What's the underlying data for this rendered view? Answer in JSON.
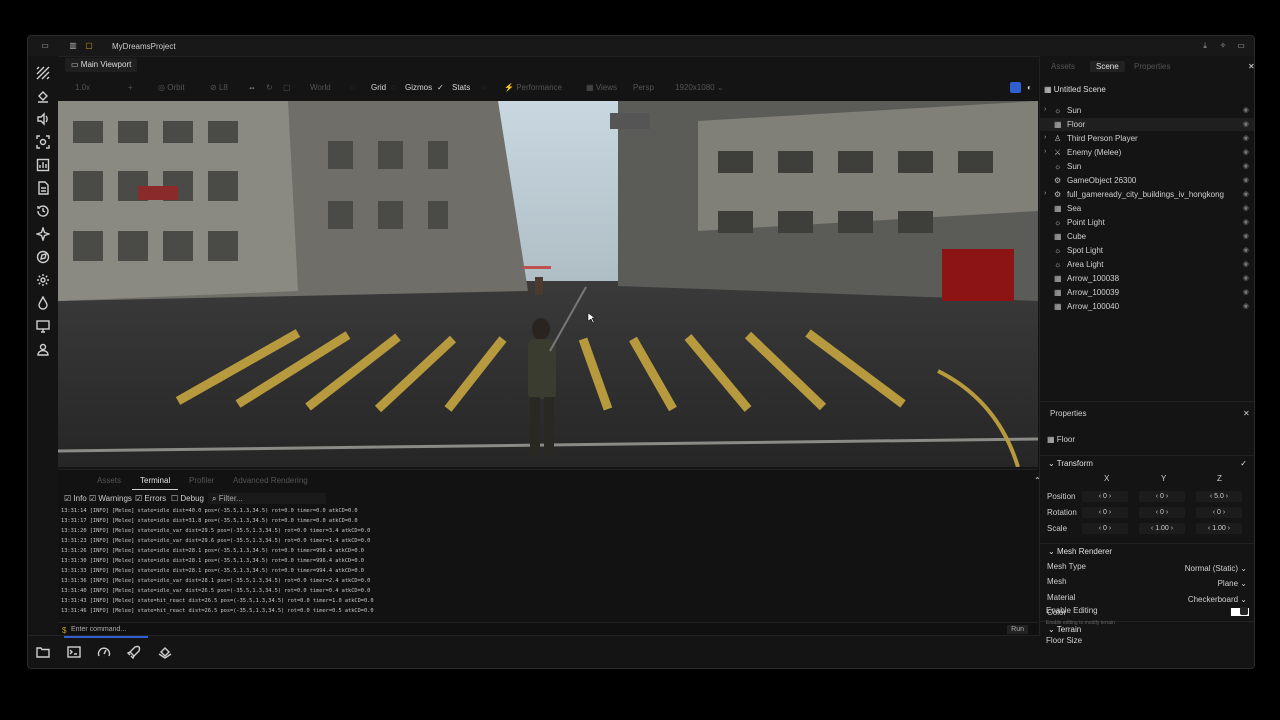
{
  "title_bar": {
    "project": "MyDreamsProject"
  },
  "viewport": {
    "tab_label": "Main Viewport",
    "toolbar": {
      "zoom": "1.0x",
      "orbit": "Orbit",
      "light": "L8",
      "world": "World",
      "grid": "Grid",
      "gizmos": "Gizmos",
      "stats": "Stats",
      "performance": "Performance",
      "views": "Views",
      "persp": "Persp",
      "resolution": "1920x1080"
    }
  },
  "bottom_panel": {
    "tabs": [
      "Assets",
      "Terminal",
      "Profiler",
      "Advanced Rendering"
    ],
    "active_tab": 1,
    "filters": {
      "info": "Info",
      "warnings": "Warnings",
      "errors": "Errors",
      "debug": "Debug",
      "filter_placeholder": "Filter..."
    },
    "log": [
      "13:31:14 [INFO] [Melee] state=idle dist=40.0 pos=(-35.5,1.3,34.5) rot=0.0 timer=0.0 atkCD=0.0",
      "13:31:17 [INFO] [Melee] state=idle dist=31.8 pos=(-35.5,1.3,34.5) rot=0.0 timer=0.0 atkCD=0.0",
      "13:31:20 [INFO] [Melee] state=idle_var dist=29.5 pos=(-35.5,1.3,34.5) rot=0.0 timer=3.4 atkCD=0.0",
      "13:31:23 [INFO] [Melee] state=idle_var dist=29.6 pos=(-35.5,1.3,34.5) rot=0.0 timer=1.4 atkCD=0.0",
      "13:31:26 [INFO] [Melee] state=idle dist=28.1 pos=(-35.5,1.3,34.5) rot=0.0 timer=998.4 atkCD=0.0",
      "13:31:30 [INFO] [Melee] state=idle dist=28.1 pos=(-35.5,1.3,34.5) rot=0.0 timer=996.4 atkCD=0.0",
      "13:31:33 [INFO] [Melee] state=idle dist=28.1 pos=(-35.5,1.3,34.5) rot=0.0 timer=994.4 atkCD=0.0",
      "13:31:36 [INFO] [Melee] state=idle_var dist=28.1 pos=(-35.5,1.3,34.5) rot=0.0 timer=2.4 atkCD=0.0",
      "13:31:40 [INFO] [Melee] state=idle_var dist=26.5 pos=(-35.5,1.3,34.5) rot=0.0 timer=0.4 atkCD=0.0",
      "13:31:43 [INFO] [Melee] state=hit_react dist=26.5 pos=(-35.5,1.3,34.5) rot=0.0 timer=1.0 atkCD=0.0",
      "13:31:46 [INFO] [Melee] state=hit_react dist=26.5 pos=(-35.5,1.3,34.5) rot=0.0 timer=0.5 atkCD=0.0"
    ],
    "command_placeholder": "Enter command...",
    "run_label": "Run"
  },
  "scene_panel": {
    "tabs": [
      "Assets",
      "Scene",
      "Properties"
    ],
    "active_tab": 1,
    "scene_name": "Untitled Scene",
    "items": [
      {
        "label": "Sun",
        "icon": "sun-icon",
        "expandable": true
      },
      {
        "label": "Floor",
        "icon": "grid-icon",
        "expandable": false,
        "selected": true
      },
      {
        "label": "Third Person Player",
        "icon": "person-icon",
        "expandable": true
      },
      {
        "label": "Enemy (Melee)",
        "icon": "run-icon",
        "expandable": true
      },
      {
        "label": "Sun",
        "icon": "sun-icon",
        "expandable": false
      },
      {
        "label": "GameObject 26300",
        "icon": "gear-icon",
        "expandable": false
      },
      {
        "label": "full_gameready_city_buildings_iv_hongkong",
        "icon": "gear-icon",
        "expandable": true
      },
      {
        "label": "Sea",
        "icon": "grid-icon",
        "expandable": false
      },
      {
        "label": "Point Light",
        "icon": "sun-icon",
        "expandable": false
      },
      {
        "label": "Cube",
        "icon": "grid-icon",
        "expandable": false
      },
      {
        "label": "Spot Light",
        "icon": "sun-icon",
        "expandable": false
      },
      {
        "label": "Area Light",
        "icon": "sun-icon",
        "expandable": false
      },
      {
        "label": "Arrow_100038",
        "icon": "grid-icon",
        "expandable": false
      },
      {
        "label": "Arrow_100039",
        "icon": "grid-icon",
        "expandable": false
      },
      {
        "label": "Arrow_100040",
        "icon": "grid-icon",
        "expandable": false
      }
    ]
  },
  "properties": {
    "title": "Properties",
    "object": "Floor",
    "transform_label": "Transform",
    "axes": [
      "X",
      "Y",
      "Z"
    ],
    "position_label": "Position",
    "position": [
      "0",
      "0",
      "5.0"
    ],
    "rotation_label": "Rotation",
    "rotation": [
      "0",
      "0",
      "0"
    ],
    "scale_label": "Scale",
    "scale": [
      "0",
      "1.00",
      "1.00"
    ],
    "mesh_renderer_label": "Mesh Renderer",
    "mesh_type_label": "Mesh Type",
    "mesh_type": "Normal (Static)",
    "mesh_label": "Mesh",
    "mesh": "Plane",
    "material_label": "Material",
    "material": "Checkerboard",
    "color_label": "Color",
    "color_value": "#ffffff",
    "terrain_label": "Terrain",
    "enable_editing_label": "Enable Editing",
    "enable_editing_hint": "Enable editing to modify terrain",
    "floor_size_label": "Floor Size"
  }
}
